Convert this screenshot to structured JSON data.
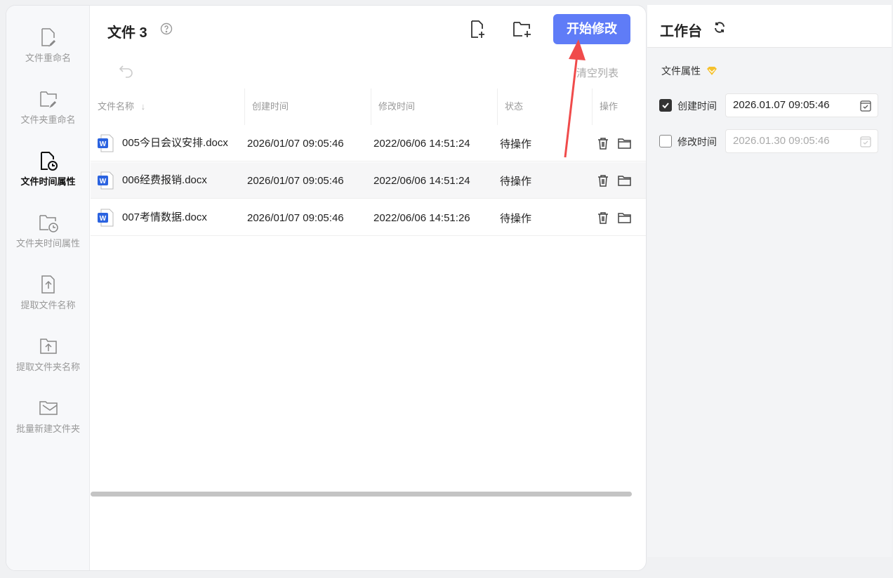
{
  "sidebar": {
    "items": [
      {
        "label": "文件重命名",
        "icon": "file-edit-icon",
        "active": false
      },
      {
        "label": "文件夹重命名",
        "icon": "folder-edit-icon",
        "active": false
      },
      {
        "label": "文件时间属性",
        "icon": "file-clock-icon",
        "active": true
      },
      {
        "label": "文件夹时间属性",
        "icon": "folder-clock-icon",
        "active": false
      },
      {
        "label": "提取文件名称",
        "icon": "file-upload-icon",
        "active": false
      },
      {
        "label": "提取文件夹名称",
        "icon": "folder-upload-icon",
        "active": false
      },
      {
        "label": "批量新建文件夹",
        "icon": "mail-folder-icon",
        "active": false
      }
    ]
  },
  "main": {
    "title": "文件 3",
    "start_label": "开始修改",
    "clear_label": "清空列表",
    "columns": [
      "文件名称",
      "创建时间",
      "修改时间",
      "状态",
      "操作"
    ],
    "rows": [
      {
        "name": "005今日会议安排.docx",
        "created": "2026/01/07 09:05:46",
        "modified": "2022/06/06 14:51:24",
        "status": "待操作"
      },
      {
        "name": "006经费报销.docx",
        "created": "2026/01/07 09:05:46",
        "modified": "2022/06/06 14:51:24",
        "status": "待操作"
      },
      {
        "name": "007考情数据.docx",
        "created": "2026/01/07 09:05:46",
        "modified": "2022/06/06 14:51:26",
        "status": "待操作"
      }
    ]
  },
  "workbench": {
    "title": "工作台",
    "section": "文件属性",
    "created": {
      "label": "创建时间",
      "value": "2026.01.07 09:05:46",
      "checked": true
    },
    "modified": {
      "label": "修改时间",
      "value": "2026.01.30 09:05:46",
      "checked": false
    }
  },
  "colors": {
    "accent": "#5f7cf7",
    "arrow": "#f04b4b",
    "gem": "#f5c12e"
  }
}
